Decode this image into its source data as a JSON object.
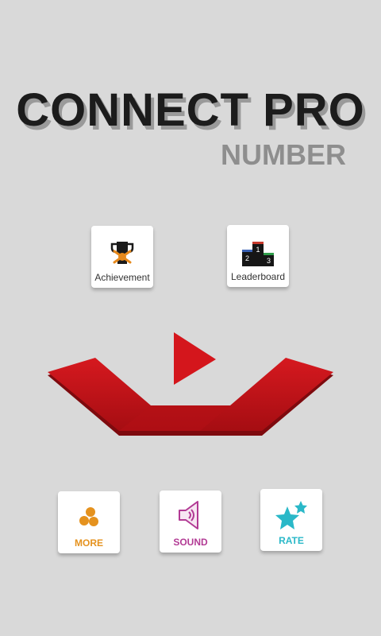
{
  "title": {
    "main": "CONNECT PRO",
    "sub": "NUMBER"
  },
  "menu": {
    "achievement_label": "Achievement",
    "leaderboard_label": "Leaderboard",
    "leaderboard_ranks": [
      "2",
      "1",
      "3"
    ],
    "more_label": "MORE",
    "sound_label": "SOUND",
    "rate_label": "RATE"
  },
  "icons": {
    "achievement": "trophy-icon",
    "leaderboard": "podium-icon",
    "play": "play-icon",
    "more": "dots-icon",
    "sound": "speaker-icon",
    "rate": "stars-icon"
  },
  "colors": {
    "background": "#d9d9d9",
    "accent_red": "#c8151b",
    "more": "#e5921e",
    "sound": "#b23a94",
    "rate": "#2ab8c8"
  }
}
